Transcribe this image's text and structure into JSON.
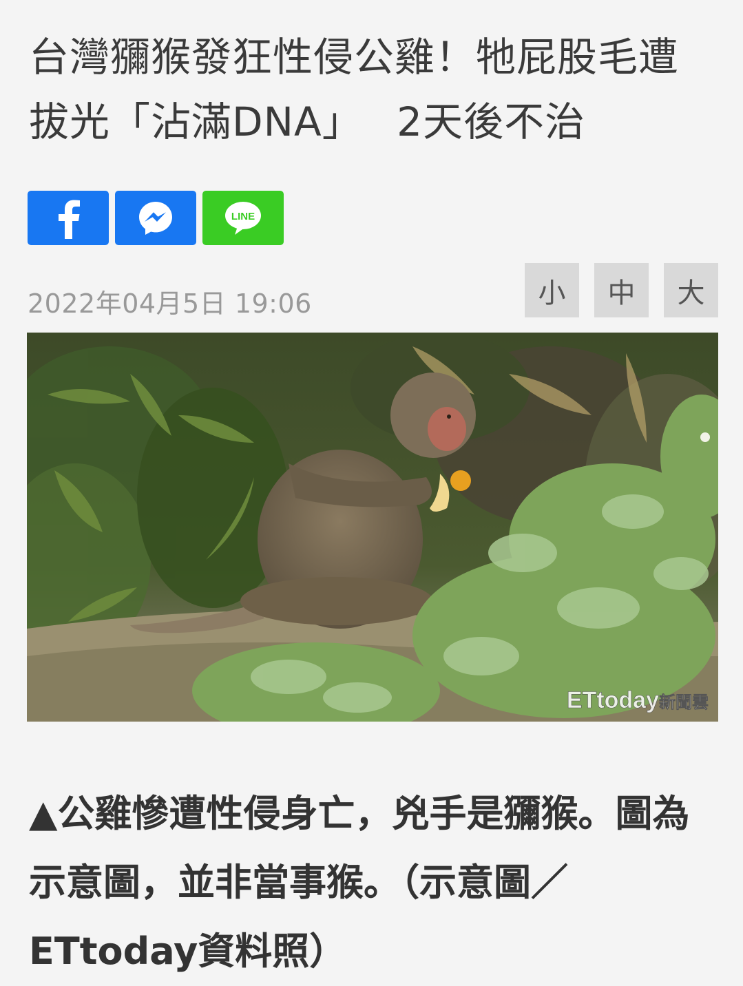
{
  "article": {
    "headline_line1": "台灣獼猴發狂性侵公雞！牠屁股毛遭",
    "headline_line2": "拔光「沾滿DNA」　 2天後不治",
    "date": "2022年04月5日 19:06",
    "caption_line1": "▲公雞慘遭性侵身亡，兇手是獼猴。圖為",
    "caption_line2": "示意圖，並非當事猴。（示意圖／",
    "caption_line3": "ETtoday資料照）"
  },
  "share": {
    "facebook_icon": "facebook-icon",
    "messenger_icon": "messenger-icon",
    "line_icon": "line-icon",
    "line_label": "LINE",
    "facebook_color": "#1877f2",
    "messenger_color": "#1877f2",
    "line_color": "#3acc24"
  },
  "font_size": {
    "small": "小",
    "medium": "中",
    "large": "大"
  },
  "photo": {
    "watermark_brand": "ETtoday",
    "watermark_suffix": "新聞雲"
  }
}
